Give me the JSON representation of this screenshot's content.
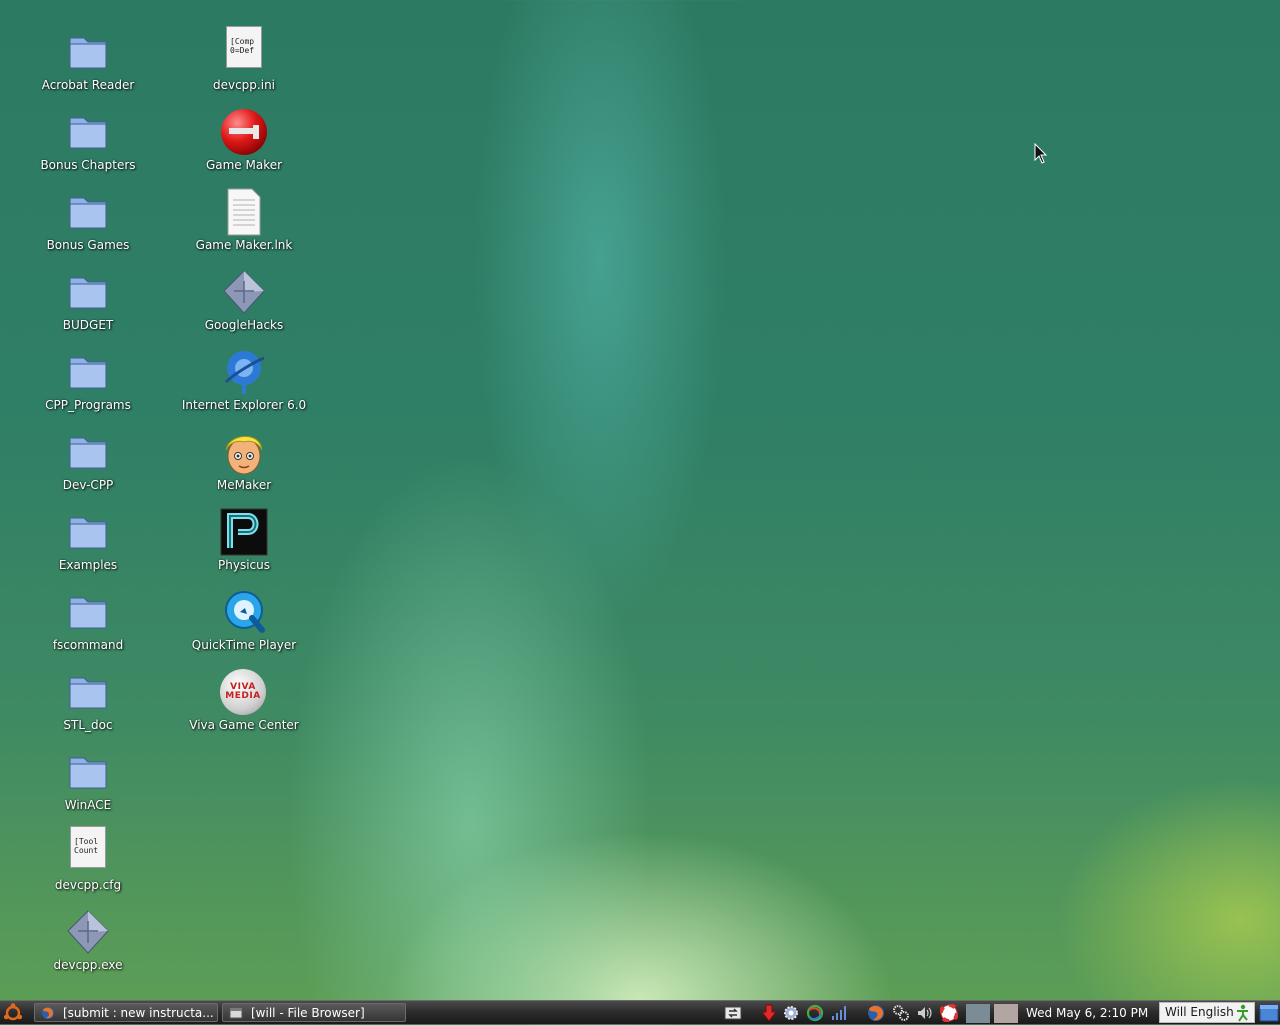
{
  "desktop": {
    "left_column": [
      {
        "label": "Acrobat Reader",
        "icon": "folder-icon"
      },
      {
        "label": "Bonus Chapters",
        "icon": "folder-icon"
      },
      {
        "label": "Bonus Games",
        "icon": "folder-icon"
      },
      {
        "label": "BUDGET",
        "icon": "folder-icon"
      },
      {
        "label": "CPP_Programs",
        "icon": "folder-icon"
      },
      {
        "label": "Dev-CPP",
        "icon": "folder-icon"
      },
      {
        "label": "Examples",
        "icon": "folder-icon"
      },
      {
        "label": "fscommand",
        "icon": "folder-icon"
      },
      {
        "label": "STL_doc",
        "icon": "folder-icon"
      },
      {
        "label": "WinACE",
        "icon": "folder-icon"
      },
      {
        "label": "devcpp.cfg",
        "icon": "text-file-icon",
        "preview": [
          "[Tool",
          "Count"
        ]
      },
      {
        "label": "devcpp.exe",
        "icon": "executable-icon"
      }
    ],
    "right_column": [
      {
        "label": "devcpp.ini",
        "icon": "text-file-icon",
        "preview": [
          "[Comp",
          "0=Def"
        ]
      },
      {
        "label": "Game Maker",
        "icon": "game-maker-icon"
      },
      {
        "label": "Game Maker.lnk",
        "icon": "document-icon"
      },
      {
        "label": "GoogleHacks",
        "icon": "executable-icon"
      },
      {
        "label": "Internet Explorer 6.0",
        "icon": "internet-explorer-icon"
      },
      {
        "label": "MeMaker",
        "icon": "memaker-icon"
      },
      {
        "label": "Physicus",
        "icon": "physicus-icon"
      },
      {
        "label": "QuickTime Player",
        "icon": "quicktime-icon"
      },
      {
        "label": "Viva Game Center",
        "icon": "viva-media-icon",
        "logo_text": "VIVA MEDIA"
      }
    ]
  },
  "taskbar": {
    "tasks": [
      {
        "label": "[submit : new instructa...",
        "icon": "firefox-icon"
      },
      {
        "label": "[will - File Browser]",
        "icon": "file-browser-icon"
      }
    ],
    "clock": "Wed May  6,  2:10 PM",
    "user": "Will English",
    "tray_icons": [
      "network-icon",
      "update-icon",
      "settings-icon",
      "compiz-icon",
      "signal-icon",
      "firefox-icon",
      "system-icon",
      "volume-icon",
      "help-icon"
    ]
  }
}
